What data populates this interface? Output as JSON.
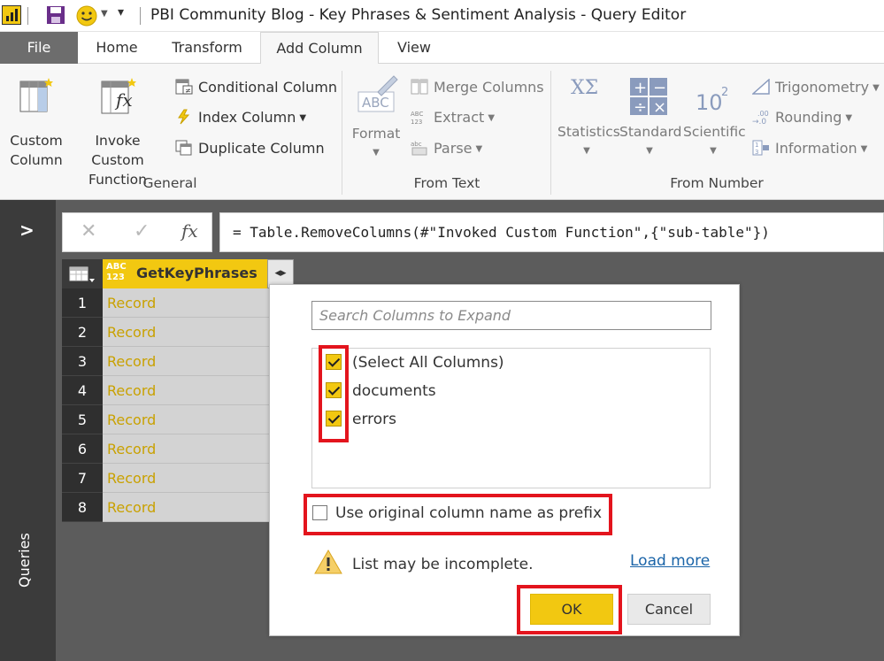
{
  "window": {
    "title": "PBI Community Blog - Key Phrases & Sentiment Analysis - Query Editor"
  },
  "tabs": [
    {
      "label": "File"
    },
    {
      "label": "Home"
    },
    {
      "label": "Transform"
    },
    {
      "label": "Add Column"
    },
    {
      "label": "View"
    }
  ],
  "ribbon": {
    "general": {
      "label": "General",
      "custom_column": "Custom\nColumn",
      "invoke_custom_function": "Invoke Custom\nFunction",
      "conditional_column": "Conditional Column",
      "index_column": "Index Column",
      "duplicate_column": "Duplicate Column"
    },
    "from_text": {
      "label": "From Text",
      "format": "Format",
      "merge_columns": "Merge Columns",
      "extract": "Extract",
      "parse": "Parse"
    },
    "from_number": {
      "label": "From Number",
      "statistics": "Statistics",
      "standard": "Standard",
      "scientific": "Scientific",
      "trigonometry": "Trigonometry",
      "rounding": "Rounding",
      "information": "Information"
    }
  },
  "queries_pane": {
    "label": "Queries"
  },
  "formula_bar": {
    "formula": "= Table.RemoveColumns(#\"Invoked Custom Function\",{\"sub-table\"})"
  },
  "grid": {
    "column": {
      "type_top": "ABC",
      "type_bottom": "123",
      "name": "GetKeyPhrases"
    },
    "rows": [
      {
        "num": "1",
        "value": "Record"
      },
      {
        "num": "2",
        "value": "Record"
      },
      {
        "num": "3",
        "value": "Record"
      },
      {
        "num": "4",
        "value": "Record"
      },
      {
        "num": "5",
        "value": "Record"
      },
      {
        "num": "6",
        "value": "Record"
      },
      {
        "num": "7",
        "value": "Record"
      },
      {
        "num": "8",
        "value": "Record"
      }
    ]
  },
  "expand_dialog": {
    "search_placeholder": "Search Columns to Expand",
    "columns": [
      {
        "label": "(Select All Columns)",
        "checked": true
      },
      {
        "label": "documents",
        "checked": true
      },
      {
        "label": "errors",
        "checked": true
      }
    ],
    "prefix_label": "Use original column name as prefix",
    "prefix_checked": false,
    "warning": "List may be incomplete.",
    "load_more": "Load more",
    "ok": "OK",
    "cancel": "Cancel"
  },
  "colors": {
    "accent": "#f2c811",
    "highlight": "#e3141d",
    "link": "#1a64a8"
  }
}
